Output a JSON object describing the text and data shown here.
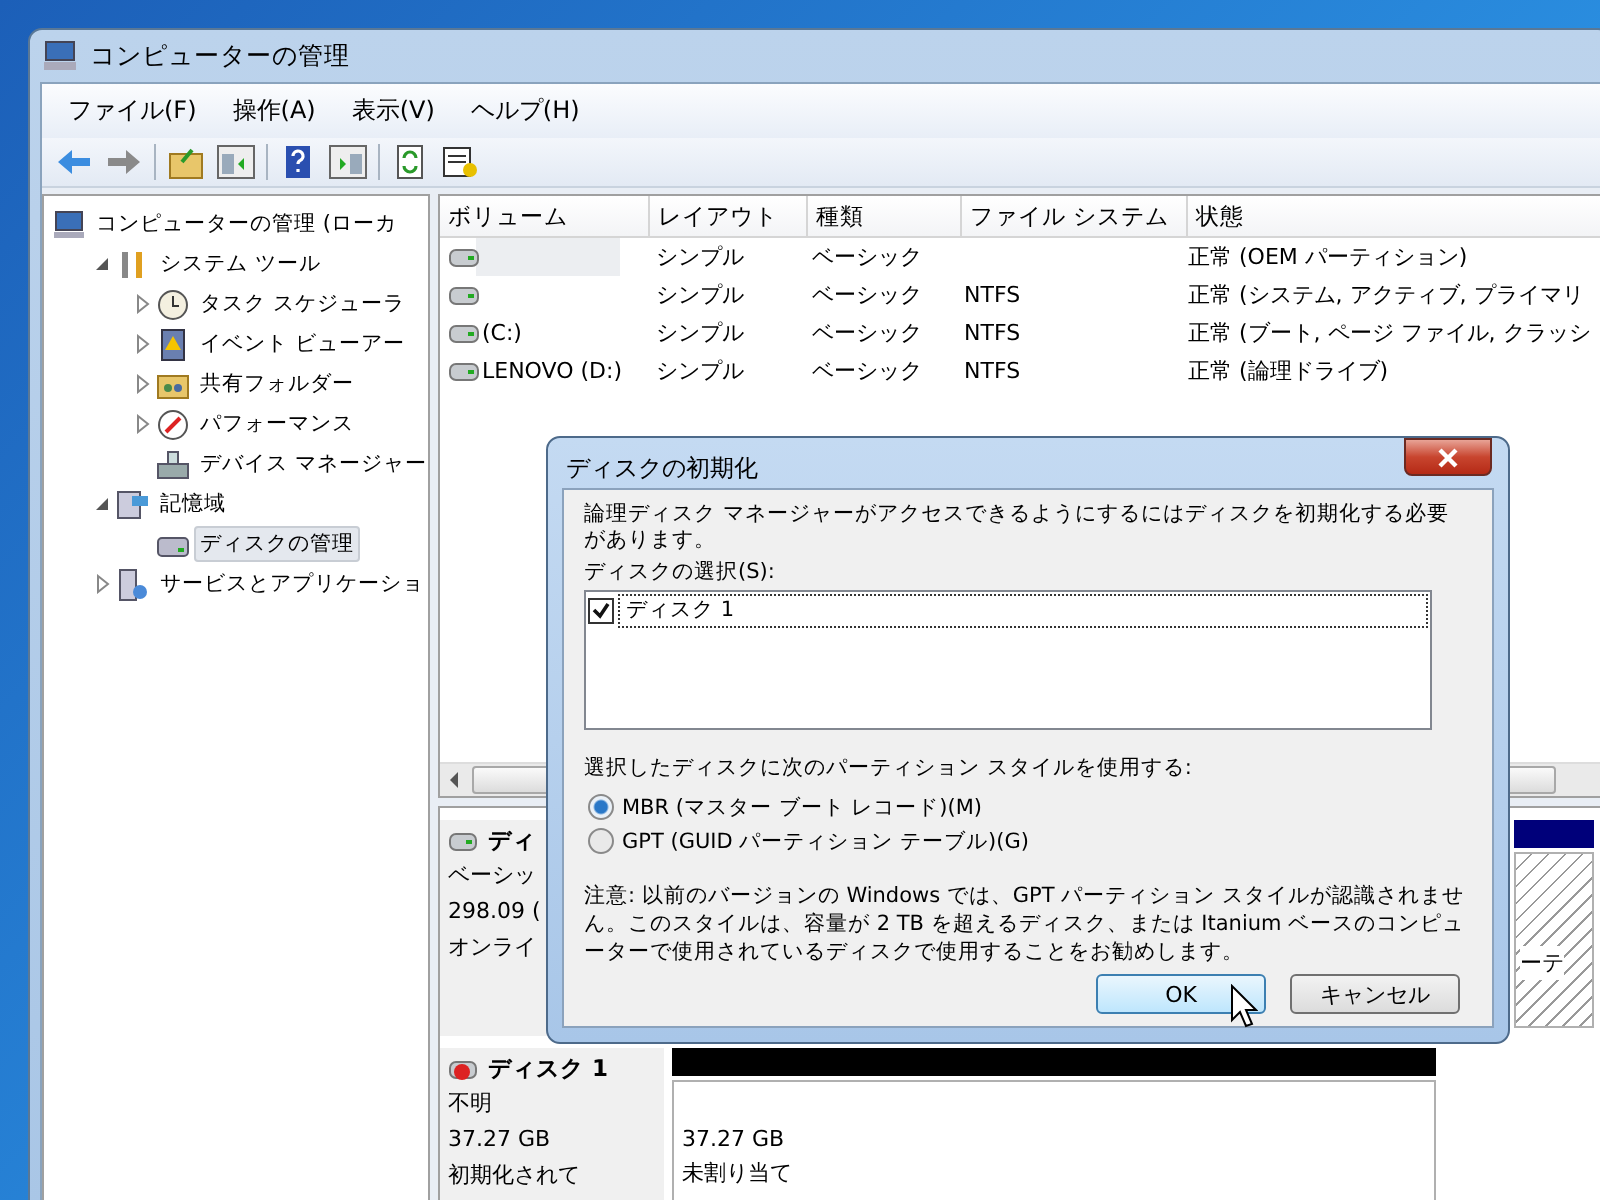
{
  "window": {
    "title": "コンピューターの管理"
  },
  "menu": [
    "ファイル(F)",
    "操作(A)",
    "表示(V)",
    "ヘルプ(H)"
  ],
  "tree": {
    "label": "コンピューターの管理 (ローカ",
    "selected": false,
    "children": [
      {
        "label": "システム ツール",
        "expanded": true,
        "selected": false,
        "children": [
          {
            "label": "タスク スケジューラ",
            "expanded": false,
            "selected": false
          },
          {
            "label": "イベント ビューアー",
            "expanded": false,
            "selected": false
          },
          {
            "label": "共有フォルダー",
            "expanded": false,
            "selected": false
          },
          {
            "label": "パフォーマンス",
            "expanded": false,
            "selected": false
          },
          {
            "label": "デバイス マネージャー",
            "selected": false
          }
        ]
      },
      {
        "label": "記憶域",
        "expanded": true,
        "selected": false,
        "children": [
          {
            "label": "ディスクの管理",
            "selected": true
          }
        ]
      },
      {
        "label": "サービスとアプリケーショ",
        "expanded": false,
        "selected": false
      }
    ]
  },
  "volumes": {
    "columns": [
      "ボリューム",
      "レイアウト",
      "種類",
      "ファイル システム",
      "状態"
    ],
    "rows": [
      {
        "layout": "シンプル",
        "type": "ベーシック",
        "status": "正常 (OEM パーティション)",
        "selected": true
      },
      {
        "layout": "シンプル",
        "type": "ベーシック",
        "filesystem": "NTFS",
        "status": "正常 (システム, アクティブ, プライマリ",
        "selected": false
      },
      {
        "volume": "(C:)",
        "layout": "シンプル",
        "type": "ベーシック",
        "filesystem": "NTFS",
        "status": "正常 (ブート, ページ ファイル, クラッシ",
        "selected": false
      },
      {
        "volume": "LENOVO (D:)",
        "layout": "シンプル",
        "type": "ベーシック",
        "filesystem": "NTFS",
        "status": "正常 (論理ドライブ)",
        "selected": false
      }
    ]
  },
  "disks": [
    {
      "name": "ディ",
      "lines": [
        "ベーシッ",
        "298.09 (",
        "オンライ"
      ],
      "partition_text": "ーテ",
      "kind": "online"
    },
    {
      "name": "ディスク 1",
      "lines": [
        "不明",
        "37.27 GB",
        "初期化されて"
      ],
      "partition_lines": [
        "37.27 GB",
        "未割り当て"
      ],
      "kind": "unknown"
    }
  ],
  "dialog": {
    "title": "ディスクの初期化",
    "message": "論理ディスク マネージャーがアクセスできるようにするにはディスクを初期化する必要があります。",
    "disk_list_label": "ディスクの選択(S):",
    "disk_items": [
      {
        "label": "ディスク 1",
        "checked": true
      }
    ],
    "style_label": "選択したディスクに次のパーティション スタイルを使用する:",
    "styles": [
      {
        "label": "MBR (マスター ブート レコード)(M)",
        "selected": true
      },
      {
        "label": "GPT (GUID パーティション テーブル)(G)",
        "selected": false
      }
    ],
    "note": "注意: 以前のバージョンの Windows では、GPT パーティション スタイルが認識されません。このスタイルは、容量が 2 TB を超えるディスク、または Itanium ベースのコンピューターで使用されているディスクで使用することをお勧めします。",
    "buttons": [
      "OK",
      "キャンセル"
    ]
  }
}
